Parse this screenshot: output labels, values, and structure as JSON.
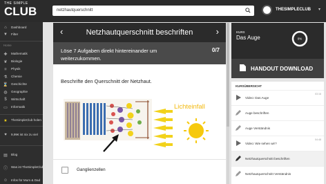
{
  "header": {
    "logo_small": "THE SIMPLE",
    "logo_big": "CLUB",
    "search_value": "netzhautquerschnitt",
    "username": "THESIMPLECLUB"
  },
  "sidebar": {
    "items_top": [
      {
        "label": "Dashboard",
        "icon": "home-icon"
      },
      {
        "label": "Filter",
        "icon": "filter-icon"
      }
    ],
    "section_label": "Home",
    "subjects": [
      {
        "label": "Mathematik",
        "icon": "math-icon"
      },
      {
        "label": "Biologie",
        "icon": "biology-icon"
      },
      {
        "label": "Physik",
        "icon": "physics-icon"
      },
      {
        "label": "Chemie",
        "icon": "chemistry-icon"
      },
      {
        "label": "Geschichte",
        "icon": "history-icon"
      },
      {
        "label": "Geographie",
        "icon": "geography-icon"
      },
      {
        "label": "Wirtschaft",
        "icon": "economy-icon"
      },
      {
        "label": "Informatik",
        "icon": "computer-icon"
      }
    ],
    "club_link": "TheSimpleClub holen",
    "promo_text": "9,99€ ist nix zu viel",
    "bottom_items": [
      {
        "label": "Blog",
        "icon": "blog-icon"
      },
      {
        "label": "Was ist TheSimpleClub?",
        "icon": "info-icon"
      },
      {
        "label": "Infos für Mum & Dad",
        "icon": "parents-icon"
      }
    ]
  },
  "main": {
    "title": "Netzhautquerschnitt beschriften",
    "task_text": "Löse 7 Aufgaben direkt hintereinander um weiterzukommen.",
    "task_count": "0/7",
    "question": "Beschrifte den Querschnitt der Netzhaut.",
    "figure_label": "Lichteinfall",
    "answer_label": "Ganglienzellen"
  },
  "course": {
    "kurs_label": "KURS",
    "name": "Das Auge",
    "progress_label": "0%",
    "handout_label": "HANDOUT DOWNLOAD"
  },
  "course_content": {
    "header": "KURSÜBERSICHT",
    "items": [
      {
        "label": "Video: Das Auge",
        "type": "video",
        "time": "03:16"
      },
      {
        "label": "Auge beschriften",
        "type": "task",
        "time": ""
      },
      {
        "label": "Auge Verständnis",
        "type": "task",
        "time": ""
      },
      {
        "label": "Video: Wie sehen wir?",
        "type": "video",
        "time": "04:48"
      },
      {
        "label": "Netzhautquerschnitt beschriften",
        "type": "task",
        "time": ""
      },
      {
        "label": "Netzhautquerschnitt Verständnis",
        "type": "task",
        "time": ""
      }
    ]
  },
  "colors": {
    "dark": "#2b2b2b",
    "bar": "#4a4a4a",
    "accent_yellow": "#f2d21b"
  }
}
